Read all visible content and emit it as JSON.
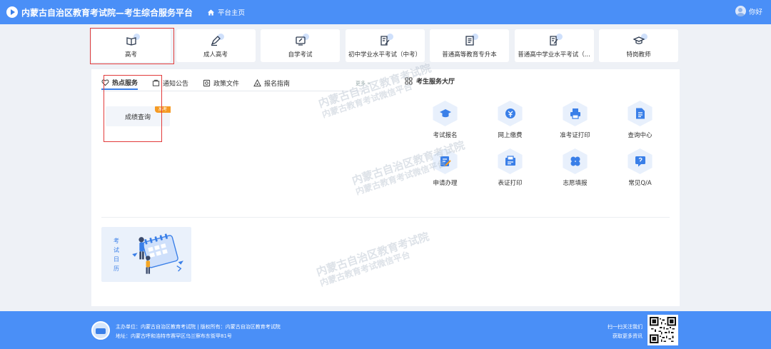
{
  "header": {
    "title": "内蒙古自治区教育考试院—考生综合服务平台",
    "home_label": "平台主页",
    "user_label": "你好"
  },
  "categories": [
    {
      "label": "高考",
      "icon": "book-open-icon"
    },
    {
      "label": "成人高考",
      "icon": "pen-icon"
    },
    {
      "label": "自学考试",
      "icon": "screen-edit-icon"
    },
    {
      "label": "初中学业水平考试（中考）",
      "icon": "document-pen-icon"
    },
    {
      "label": "普通高等教育专升本",
      "icon": "document-list-icon"
    },
    {
      "label": "普通高中学业水平考试（...",
      "icon": "document-edit-icon"
    },
    {
      "label": "特岗教师",
      "icon": "graduation-cap-icon"
    }
  ],
  "tabs": [
    {
      "label": "热点服务",
      "icon": "heart-icon",
      "active": true
    },
    {
      "label": "通知公告",
      "icon": "notice-icon"
    },
    {
      "label": "政策文件",
      "icon": "policy-file-icon"
    },
    {
      "label": "报名指南",
      "icon": "guide-icon"
    }
  ],
  "more_label": "更多 »",
  "hot_service": {
    "label": "成绩查询",
    "badge": "高考"
  },
  "service_hall": {
    "title": "考生服务大厅",
    "items": [
      {
        "label": "考试报名",
        "icon": "graduation-cap-icon"
      },
      {
        "label": "网上缴费",
        "icon": "coin-icon"
      },
      {
        "label": "准考证打印",
        "icon": "printer-icon"
      },
      {
        "label": "查询中心",
        "icon": "document-search-icon"
      },
      {
        "label": "申请办理",
        "icon": "apply-edit-icon"
      },
      {
        "label": "表证打印",
        "icon": "card-print-icon"
      },
      {
        "label": "志愿填报",
        "icon": "clover-icon"
      },
      {
        "label": "常见Q/A",
        "icon": "faq-icon"
      }
    ]
  },
  "calendar": {
    "label_chars": [
      "考",
      "试",
      "日",
      "历"
    ]
  },
  "watermark": {
    "line1": "内蒙古自治区教育考试院",
    "line2": "内蒙古教育考试微信平台"
  },
  "footer": {
    "line1": "主办单位：内蒙古自治区教育考试院 | 版权所有：内蒙古自治区教育考试院",
    "line2": "地址：内蒙古呼和浩特市赛罕区乌兰察布东街甲81号",
    "scan_line1": "扫一扫关注我们",
    "scan_line2": "获取更多资讯"
  },
  "colors": {
    "primary": "#4a8ff7",
    "highlight_border": "#e23b3b",
    "badge": "#f59a23"
  }
}
